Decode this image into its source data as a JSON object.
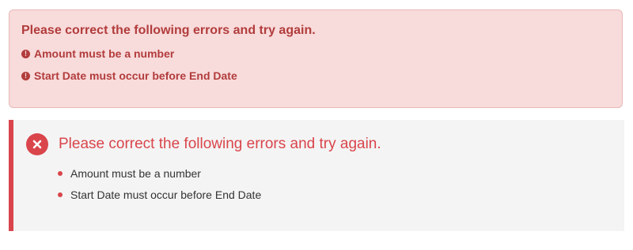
{
  "alert_compact": {
    "title": "Please correct the following errors and try again.",
    "icon": "exclamation-circle-icon",
    "errors": [
      "Amount must be a number",
      "Start Date must occur before End Date"
    ]
  },
  "alert_bordered": {
    "title": "Please correct the following errors and try again.",
    "icon": "x-circle-icon",
    "errors": [
      "Amount must be a number",
      "Start Date must occur before End Date"
    ]
  },
  "colors": {
    "compact_text": "#b23c3c",
    "compact_bg": "#f8dbdb",
    "accent_red": "#d9454b",
    "bordered_bg": "#f4f4f4"
  }
}
